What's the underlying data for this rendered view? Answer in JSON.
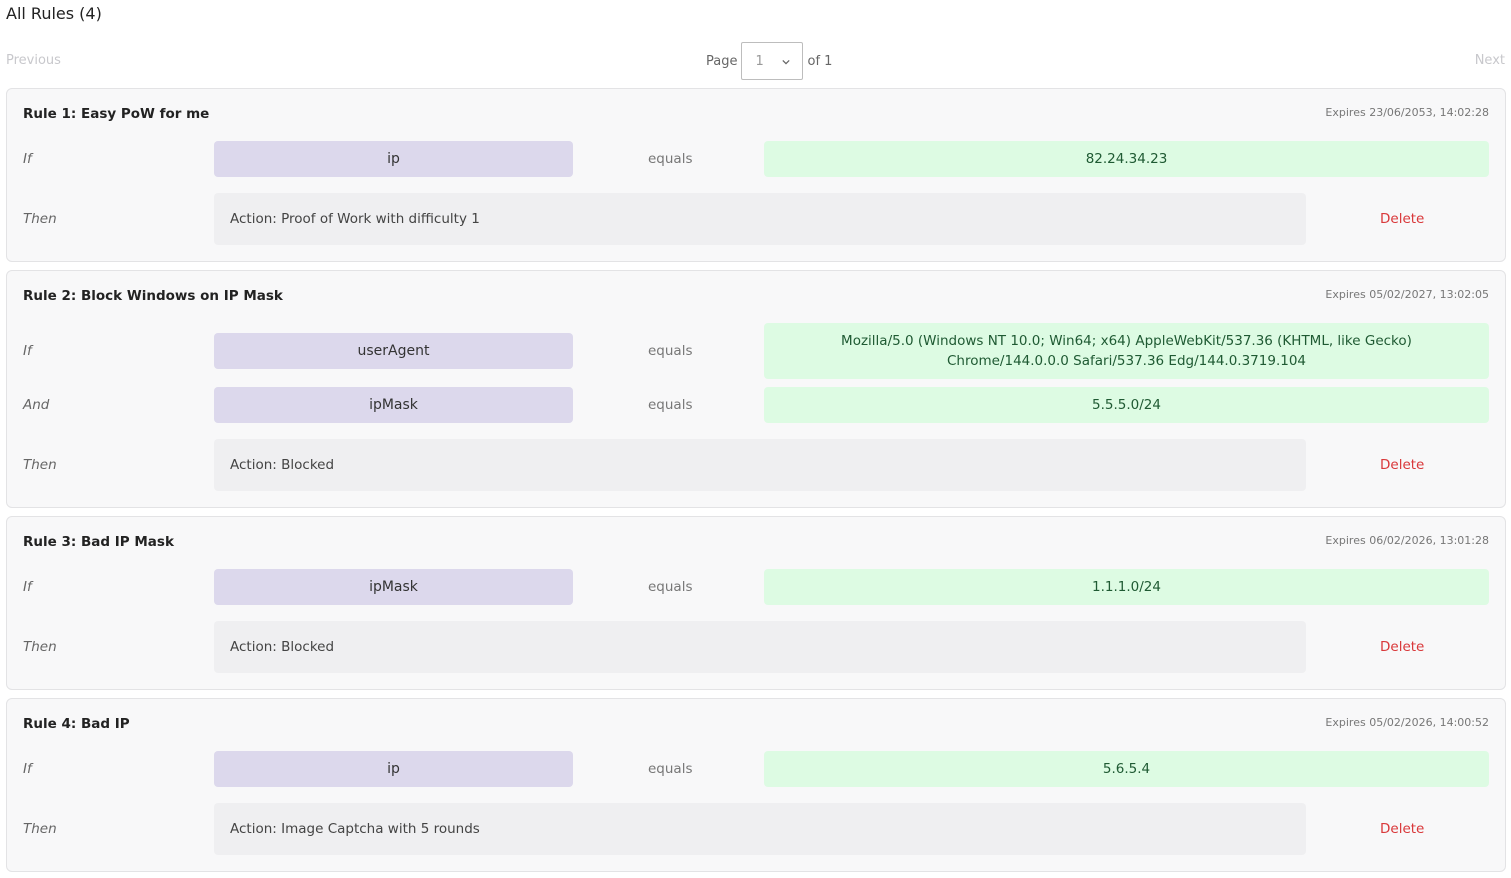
{
  "header": {
    "title": "All Rules (4)"
  },
  "pagination": {
    "previous_label": "Previous",
    "next_label": "Next",
    "page_label": "Page",
    "current_page": "1",
    "of_label": "of 1"
  },
  "labels": {
    "if": "If",
    "and": "And",
    "then": "Then",
    "equals": "equals",
    "delete": "Delete"
  },
  "rules": [
    {
      "title": "Rule 1: Easy PoW for me",
      "expires": "Expires 23/06/2053, 14:02:28",
      "conditions": [
        {
          "key": "ip",
          "value": "82.24.34.23"
        }
      ],
      "action": "Action: Proof of Work with difficulty 1"
    },
    {
      "title": "Rule 2: Block Windows on IP Mask",
      "expires": "Expires 05/02/2027, 13:02:05",
      "conditions": [
        {
          "key": "userAgent",
          "value": "Mozilla/5.0 (Windows NT 10.0; Win64; x64) AppleWebKit/537.36 (KHTML, like Gecko) Chrome/144.0.0.0 Safari/537.36 Edg/144.0.3719.104"
        },
        {
          "key": "ipMask",
          "value": "5.5.5.0/24"
        }
      ],
      "action": "Action: Blocked"
    },
    {
      "title": "Rule 3: Bad IP Mask",
      "expires": "Expires 06/02/2026, 13:01:28",
      "conditions": [
        {
          "key": "ipMask",
          "value": "1.1.1.0/24"
        }
      ],
      "action": "Action: Blocked"
    },
    {
      "title": "Rule 4: Bad IP",
      "expires": "Expires 05/02/2026, 14:00:52",
      "conditions": [
        {
          "key": "ip",
          "value": "5.6.5.4"
        }
      ],
      "action": "Action: Image Captcha with 5 rounds"
    }
  ]
}
